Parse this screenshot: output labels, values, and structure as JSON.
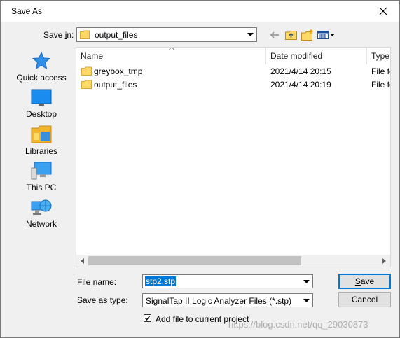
{
  "window": {
    "title": "Save As"
  },
  "save_in": {
    "label_pre": "Save ",
    "label_mnemonic": "i",
    "label_post": "n:",
    "value": "output_files"
  },
  "toolbar": {
    "back_icon": "back-arrow-icon",
    "up_icon": "up-folder-icon",
    "new_folder_icon": "new-folder-icon",
    "view_icon": "view-menu-icon"
  },
  "places": [
    {
      "label": "Quick access",
      "icon": "quick-access-star-icon"
    },
    {
      "label": "Desktop",
      "icon": "desktop-icon"
    },
    {
      "label": "Libraries",
      "icon": "libraries-icon"
    },
    {
      "label": "This PC",
      "icon": "this-pc-icon"
    },
    {
      "label": "Network",
      "icon": "network-icon"
    }
  ],
  "columns": {
    "name": "Name",
    "date": "Date modified",
    "type": "Type"
  },
  "files": [
    {
      "name": "greybox_tmp",
      "date": "2021/4/14 20:15",
      "type": "File fo"
    },
    {
      "name": "output_files",
      "date": "2021/4/14 20:19",
      "type": "File fo"
    }
  ],
  "file_name": {
    "label_pre": "File ",
    "label_mnemonic": "n",
    "label_post": "ame:",
    "value": "stp2.stp"
  },
  "save_as_type": {
    "label_pre": "Save as ",
    "label_mnemonic": "t",
    "label_post": "ype:",
    "value": "SignalTap II Logic Analyzer Files (*.stp)"
  },
  "buttons": {
    "save_mnemonic": "S",
    "save_rest": "ave",
    "cancel": "Cancel"
  },
  "add_file": {
    "label_pre": "Add file to current ",
    "label_mnemonic": "p",
    "label_post": "roject",
    "checked": true
  },
  "watermark": "https://blog.csdn.net/qq_29030873",
  "colors": {
    "accent": "#0078d7",
    "folder": "#ffd966"
  }
}
